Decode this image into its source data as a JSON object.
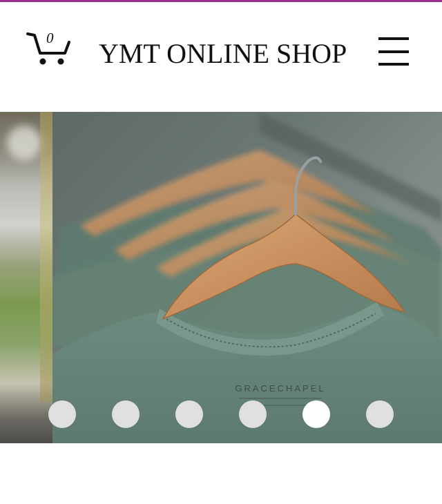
{
  "header": {
    "cart_count": "0",
    "cart_icon": "cart-icon",
    "title": "YMT ONLINE SHOP",
    "menu_icon": "hamburger-menu-icon"
  },
  "slideshow": {
    "slide_count": 6,
    "active_index": 4,
    "current_slide_label": "GRACECHAPEL"
  },
  "colors": {
    "accent_top_bar": "#9b2f8e",
    "title_text": "#111111",
    "dot_inactive": "#e0e0e0",
    "dot_active": "#ffffff"
  }
}
